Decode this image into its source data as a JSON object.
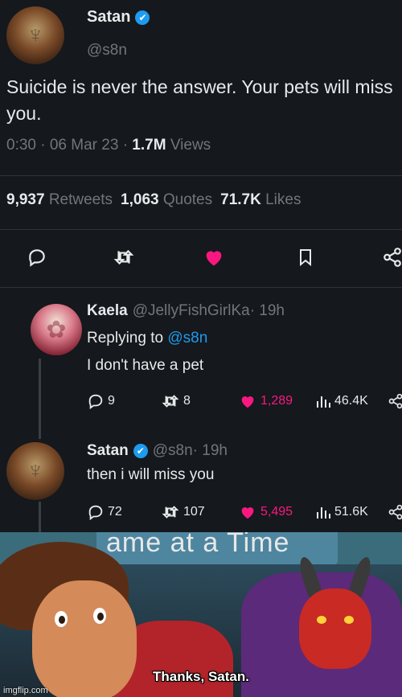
{
  "main_tweet": {
    "display_name": "Satan",
    "verified_glyph": "✔",
    "handle": "@s8n",
    "text": "Suicide is never the answer. Your pets will miss you.",
    "time": "0:30 · 06 Mar 23 · ",
    "views_count": "1.7M",
    "views_label": " Views",
    "retweets_count": "9,937",
    "retweets_label": "Retweets",
    "quotes_count": "1,063",
    "quotes_label": "Quotes",
    "likes_count": "71.7K",
    "likes_label": "Likes",
    "actions": [
      "reply-icon",
      "retweet-icon",
      "like-icon",
      "bookmark-icon",
      "share-icon"
    ]
  },
  "reply_1": {
    "display_name": "Kaela",
    "handle": "@JellyFishGirlKa",
    "time": " · 19h",
    "replying_prefix": "Replying to ",
    "replying_to": "@s8n",
    "text": "I don't have a pet",
    "replies": "9",
    "retweets": "8",
    "likes": "1,289",
    "views": "46.4K"
  },
  "reply_2": {
    "display_name": "Satan",
    "handle": "@s8n",
    "time": " · 19h",
    "text": "then i will miss you",
    "replies": "72",
    "retweets": "107",
    "likes": "5,495",
    "views": "51.6K"
  },
  "meme": {
    "banner_text": "ame at a Time",
    "subtitle": "Thanks, Satan.",
    "watermark": "imgflip.com"
  },
  "colors": {
    "background": "#15181c",
    "text": "#e7e9ea",
    "muted": "#71767b",
    "link": "#1d9bf0",
    "like": "#f91880"
  }
}
